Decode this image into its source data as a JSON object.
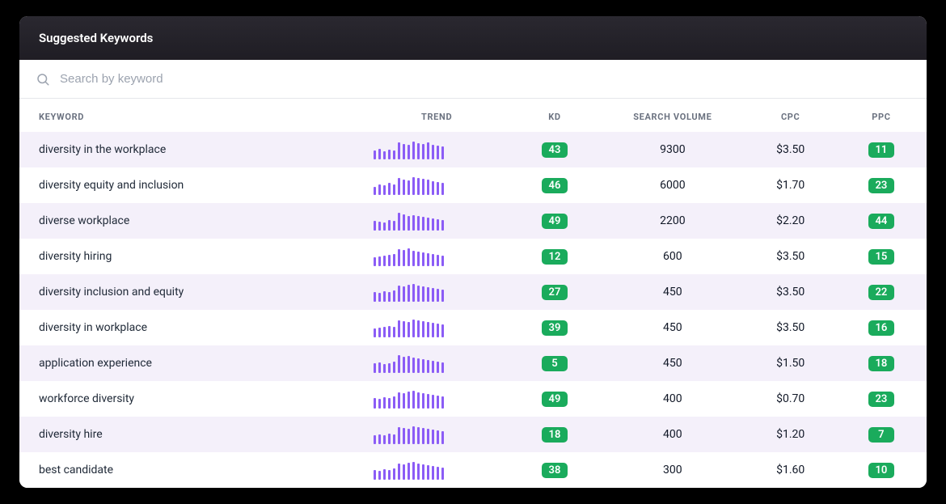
{
  "header": {
    "title": "Suggested Keywords"
  },
  "search": {
    "placeholder": "Search by keyword"
  },
  "columns": {
    "keyword": "KEYWORD",
    "trend": "TREND",
    "kd": "KD",
    "searchVolume": "SEARCH VOLUME",
    "cpc": "CPC",
    "ppc": "PPC"
  },
  "colors": {
    "badge": "#1aab5c",
    "spark": "#8b5cf6",
    "rowAlt": "#f4f0fa"
  },
  "rows": [
    {
      "keyword": "diversity in the workplace",
      "trend": [
        11,
        13,
        10,
        12,
        11,
        21,
        19,
        18,
        22,
        20,
        19,
        21,
        18,
        17,
        16
      ],
      "kd": "43",
      "searchVolume": "9300",
      "cpc": "$3.50",
      "ppc": "11"
    },
    {
      "keyword": "diversity equity and inclusion",
      "trend": [
        10,
        12,
        11,
        14,
        12,
        20,
        18,
        17,
        21,
        20,
        19,
        18,
        16,
        15,
        14
      ],
      "kd": "46",
      "searchVolume": "6000",
      "cpc": "$1.70",
      "ppc": "23"
    },
    {
      "keyword": "diverse workplace",
      "trend": [
        12,
        11,
        10,
        13,
        12,
        22,
        20,
        18,
        19,
        18,
        17,
        16,
        15,
        14,
        13
      ],
      "kd": "49",
      "searchVolume": "2200",
      "cpc": "$2.20",
      "ppc": "44"
    },
    {
      "keyword": "diversity hiring",
      "trend": [
        11,
        12,
        13,
        14,
        15,
        21,
        20,
        22,
        19,
        18,
        17,
        16,
        15,
        14,
        13
      ],
      "kd": "12",
      "searchVolume": "600",
      "cpc": "$3.50",
      "ppc": "15"
    },
    {
      "keyword": "diversity inclusion and equity",
      "trend": [
        12,
        11,
        13,
        12,
        14,
        20,
        19,
        21,
        22,
        20,
        19,
        18,
        17,
        16,
        15
      ],
      "kd": "27",
      "searchVolume": "450",
      "cpc": "$3.50",
      "ppc": "22"
    },
    {
      "keyword": "diversity in workplace",
      "trend": [
        11,
        12,
        13,
        14,
        13,
        21,
        20,
        19,
        22,
        21,
        20,
        19,
        18,
        17,
        16
      ],
      "kd": "39",
      "searchVolume": "450",
      "cpc": "$3.50",
      "ppc": "16"
    },
    {
      "keyword": "application experience",
      "trend": [
        12,
        13,
        11,
        12,
        14,
        22,
        20,
        21,
        19,
        18,
        17,
        16,
        15,
        14,
        13
      ],
      "kd": "5",
      "searchVolume": "450",
      "cpc": "$1.50",
      "ppc": "18"
    },
    {
      "keyword": "workforce diversity",
      "trend": [
        13,
        12,
        14,
        13,
        15,
        20,
        19,
        21,
        22,
        20,
        19,
        18,
        17,
        16,
        15
      ],
      "kd": "49",
      "searchVolume": "400",
      "cpc": "$0.70",
      "ppc": "23"
    },
    {
      "keyword": "diversity hire",
      "trend": [
        11,
        12,
        11,
        13,
        12,
        21,
        20,
        19,
        22,
        21,
        20,
        19,
        18,
        17,
        16
      ],
      "kd": "18",
      "searchVolume": "400",
      "cpc": "$1.20",
      "ppc": "7"
    },
    {
      "keyword": "best candidate",
      "trend": [
        12,
        11,
        13,
        12,
        14,
        20,
        19,
        21,
        22,
        20,
        19,
        18,
        17,
        16,
        15
      ],
      "kd": "38",
      "searchVolume": "300",
      "cpc": "$1.60",
      "ppc": "10"
    }
  ]
}
